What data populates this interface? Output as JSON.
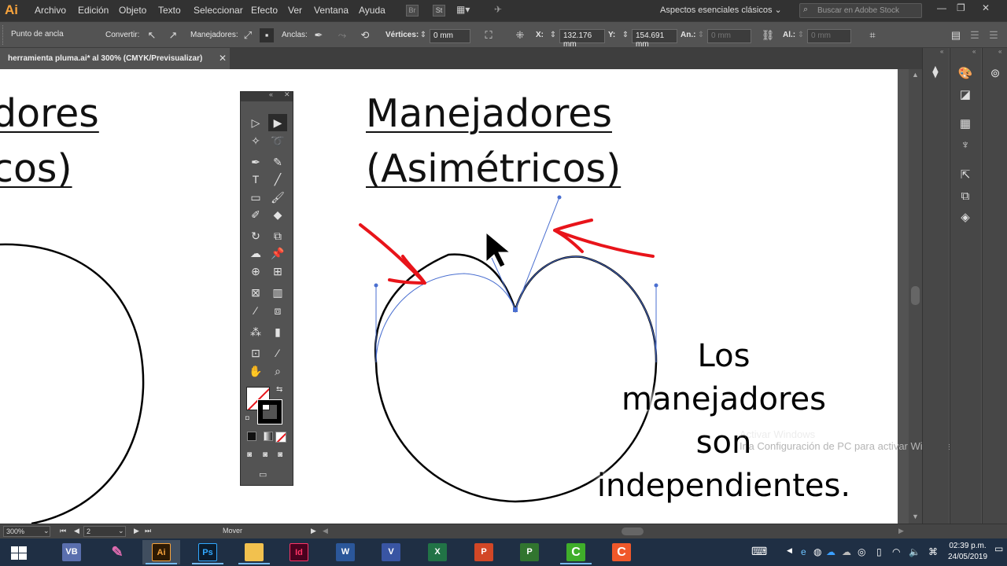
{
  "app": {
    "logo": "Ai",
    "name": "Adobe Illustrator"
  },
  "menu": [
    "Archivo",
    "Edición",
    "Objeto",
    "Texto",
    "Seleccionar",
    "Efecto",
    "Ver",
    "Ventana",
    "Ayuda"
  ],
  "top_icons": [
    "Br",
    "St"
  ],
  "workspace": "Aspectos esenciales clásicos",
  "stock_search_placeholder": "Buscar en Adobe Stock",
  "control_bar": {
    "anchor_label": "Punto de ancla",
    "convert_label": "Convertir:",
    "handles_label": "Manejadores:",
    "anchors_label": "Anclas:",
    "vertices_label": "Vértices:",
    "vertices_value": "0 mm",
    "x_label": "X:",
    "x_value": "132.176 mm",
    "y_label": "Y:",
    "y_value": "154.691 mm",
    "width_label": "An.:",
    "width_value": "0 mm",
    "height_label": "Al.:",
    "height_value": "0 mm"
  },
  "document_tab": "herramienta pluma.ai* al 300% (CMYK/Previsualizar)",
  "canvas": {
    "left_text_line1": "dores",
    "left_text_line2": "cos)",
    "title_line1": "Manejadores",
    "title_line2": "(Asimétricos)",
    "caption_lines": [
      "Los",
      "manejadores",
      "son",
      "independientes."
    ],
    "watermark_line1": "Activar Windows",
    "watermark_line2": "Ir a Configuración de PC para activar Windows."
  },
  "status_bar": {
    "zoom": "300%",
    "artboard": "2",
    "tool": "Mover"
  },
  "taskbar": {
    "apps": [
      {
        "name": "windows-start",
        "label": ""
      },
      {
        "name": "vb",
        "label": "VB"
      },
      {
        "name": "paint",
        "label": ""
      },
      {
        "name": "illustrator",
        "label": "Ai"
      },
      {
        "name": "photoshop",
        "label": "Ps"
      },
      {
        "name": "explorer",
        "label": ""
      },
      {
        "name": "indesign",
        "label": "Id"
      },
      {
        "name": "word",
        "label": "W"
      },
      {
        "name": "visio",
        "label": "V"
      },
      {
        "name": "excel",
        "label": "X"
      },
      {
        "name": "powerpoint",
        "label": "P"
      },
      {
        "name": "project",
        "label": "P"
      },
      {
        "name": "camtasia-green",
        "label": "C"
      },
      {
        "name": "camtasia-orange",
        "label": "C"
      }
    ],
    "time": "02:39 p.m.",
    "date": "24/05/2019"
  },
  "colors": {
    "accent_red": "#e8141a",
    "path_blue": "#4a6fd0",
    "illustrator_orange": "#f7a33c"
  }
}
